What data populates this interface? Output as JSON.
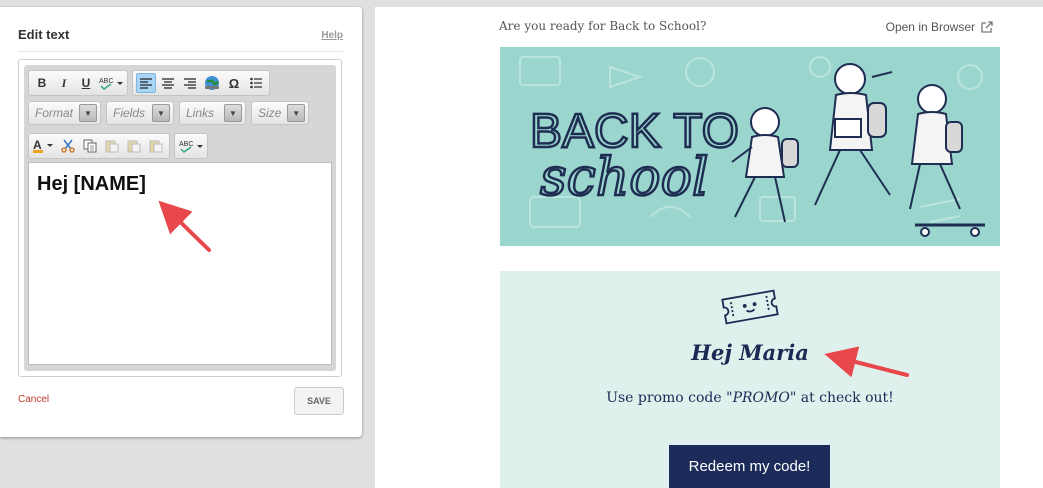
{
  "editor_panel": {
    "title": "Edit text",
    "help_link": "Help",
    "toolbar": {
      "row1": [
        {
          "icon": "bold-icon",
          "glyph": "B"
        },
        {
          "icon": "italic-icon",
          "glyph": "I"
        },
        {
          "icon": "underline-icon",
          "glyph": "U"
        },
        {
          "icon": "spellcheck-icon",
          "glyph": "ABC▾"
        },
        {
          "icon": "align-left-icon",
          "glyph": "≡",
          "active": true
        },
        {
          "icon": "align-center-icon",
          "glyph": "≡"
        },
        {
          "icon": "align-right-icon",
          "glyph": "≡"
        },
        {
          "icon": "link-globe-icon",
          "glyph": "🌐"
        },
        {
          "icon": "special-character-icon",
          "glyph": "Ω"
        },
        {
          "icon": "bulleted-list-icon",
          "glyph": "☰"
        }
      ],
      "combos": [
        "Format",
        "Fields",
        "Links",
        "Size"
      ],
      "row3": [
        {
          "icon": "text-color-icon",
          "glyph": "A▾"
        },
        {
          "icon": "cut-icon",
          "glyph": "✂"
        },
        {
          "icon": "copy-icon",
          "glyph": "⎘"
        },
        {
          "icon": "paste-icon",
          "glyph": "📋"
        },
        {
          "icon": "paste-text-icon",
          "glyph": "📋"
        },
        {
          "icon": "paste-word-icon",
          "glyph": "📋"
        },
        {
          "icon": "spellcheck-icon",
          "glyph": "ABC▾"
        }
      ]
    },
    "content": "Hej [NAME]",
    "cancel": "Cancel",
    "save": "SAVE"
  },
  "preview": {
    "preheader": "Are you ready for Back to School?",
    "open_in_browser": "Open in Browser",
    "banner_text_line1": "BACK TO",
    "banner_text_line2": "school",
    "greeting": "Hej Maria",
    "promo_prefix": "Use promo code ",
    "promo_code": "\"PROMO\"",
    "promo_suffix": " at check out!",
    "cta": "Redeem my code!"
  },
  "colors": {
    "banner_bg": "#9ad6cd",
    "content_bg": "#e0f0ec",
    "navy": "#1c2b5a",
    "annotation_arrow": "#e8474c"
  }
}
